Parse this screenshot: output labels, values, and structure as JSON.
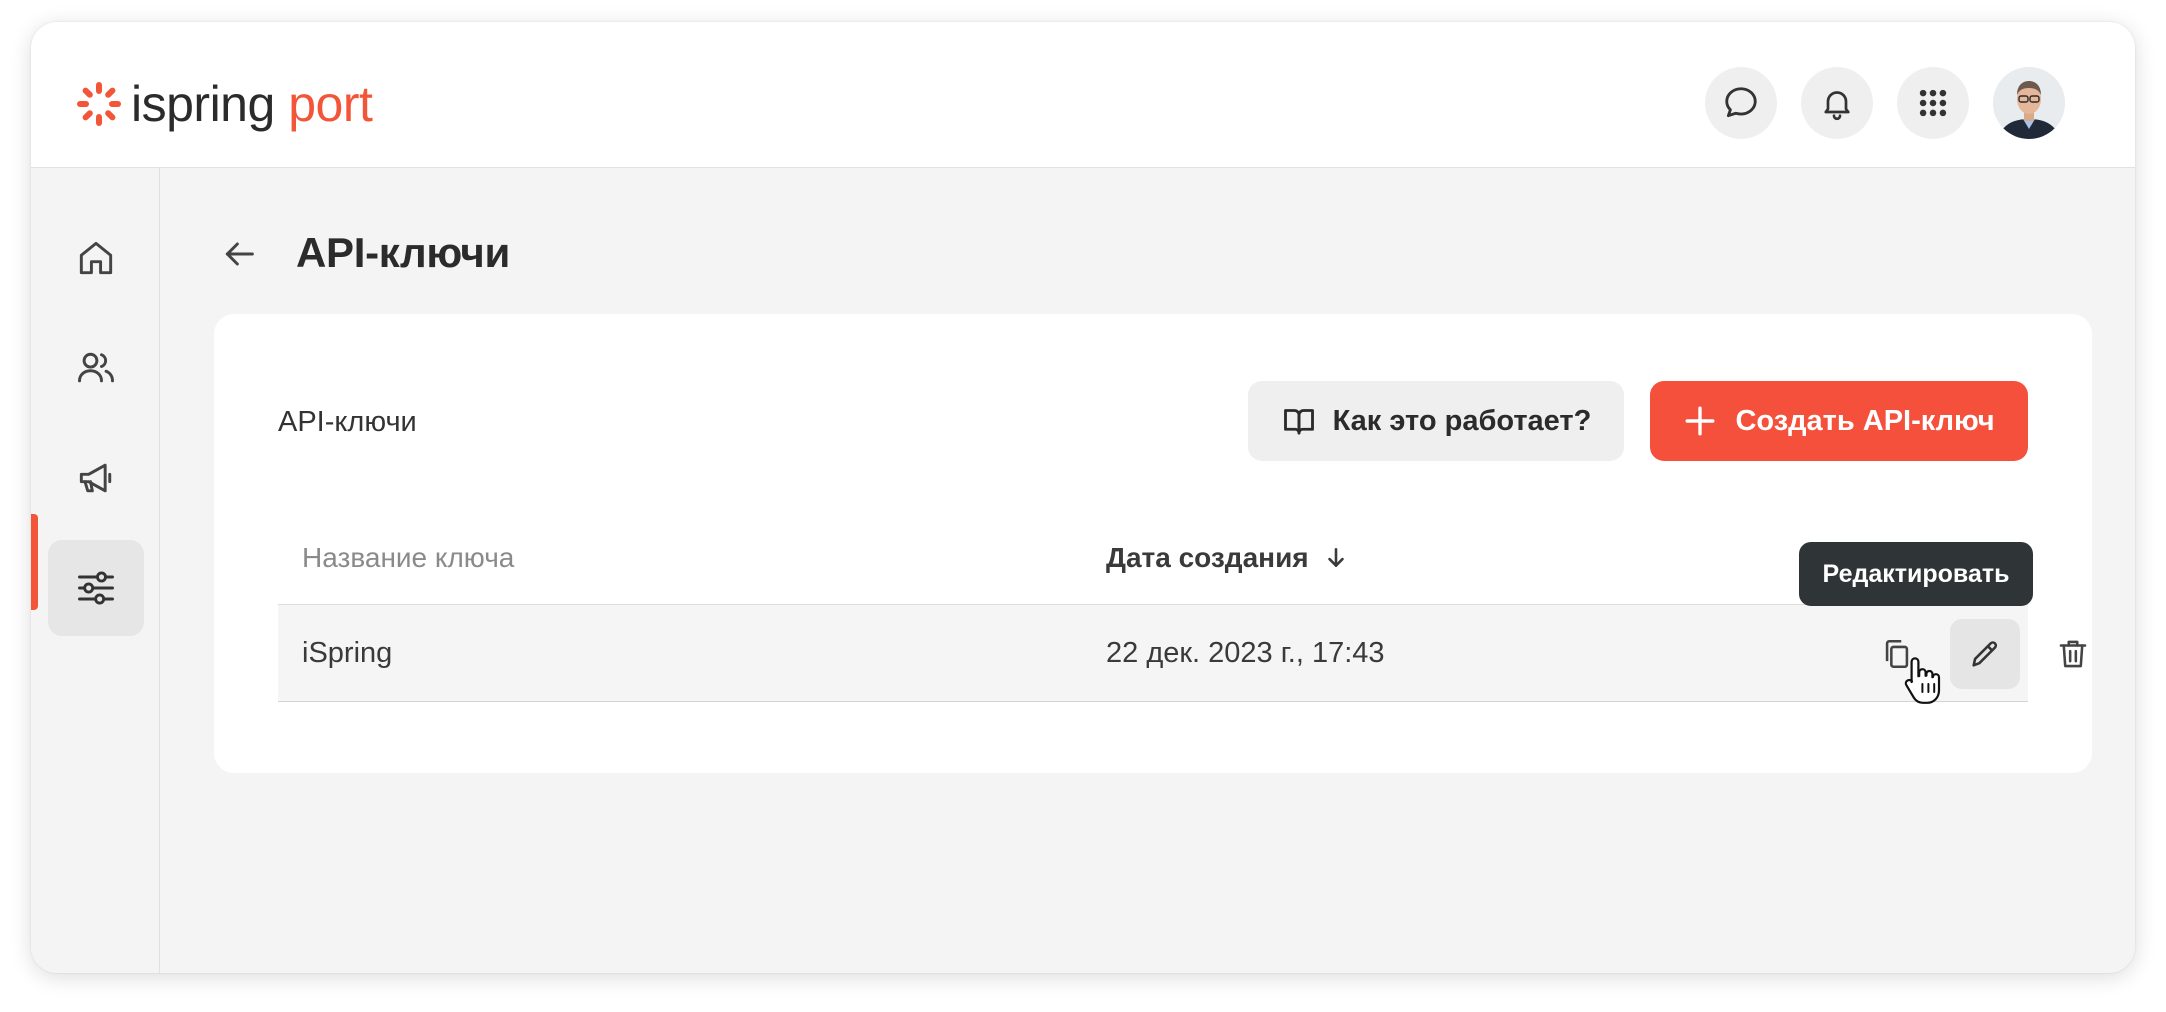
{
  "app": {
    "brand_name": "ispring",
    "brand_accent": "port",
    "brand_color": "#f25538"
  },
  "header": {
    "icons": [
      "chat-icon",
      "bell-icon",
      "apps-grid-icon"
    ],
    "avatar": "user-avatar"
  },
  "sidebar": {
    "items": [
      {
        "name": "home",
        "icon": "home-icon",
        "active": false
      },
      {
        "name": "users",
        "icon": "users-icon",
        "active": false
      },
      {
        "name": "announcements",
        "icon": "megaphone-icon",
        "active": false
      },
      {
        "name": "settings",
        "icon": "sliders-icon",
        "active": true
      }
    ]
  },
  "page": {
    "title": "API-ключи"
  },
  "card": {
    "title": "API-ключи",
    "how_it_works_label": "Как это работает?",
    "create_label": "Создать API-ключ"
  },
  "table": {
    "columns": [
      "Название ключа",
      "Дата создания"
    ],
    "rows": [
      {
        "name": "iSpring",
        "date": "22 дек. 2023 г., 17:43"
      }
    ]
  },
  "tooltip": {
    "text": "Редактировать"
  }
}
